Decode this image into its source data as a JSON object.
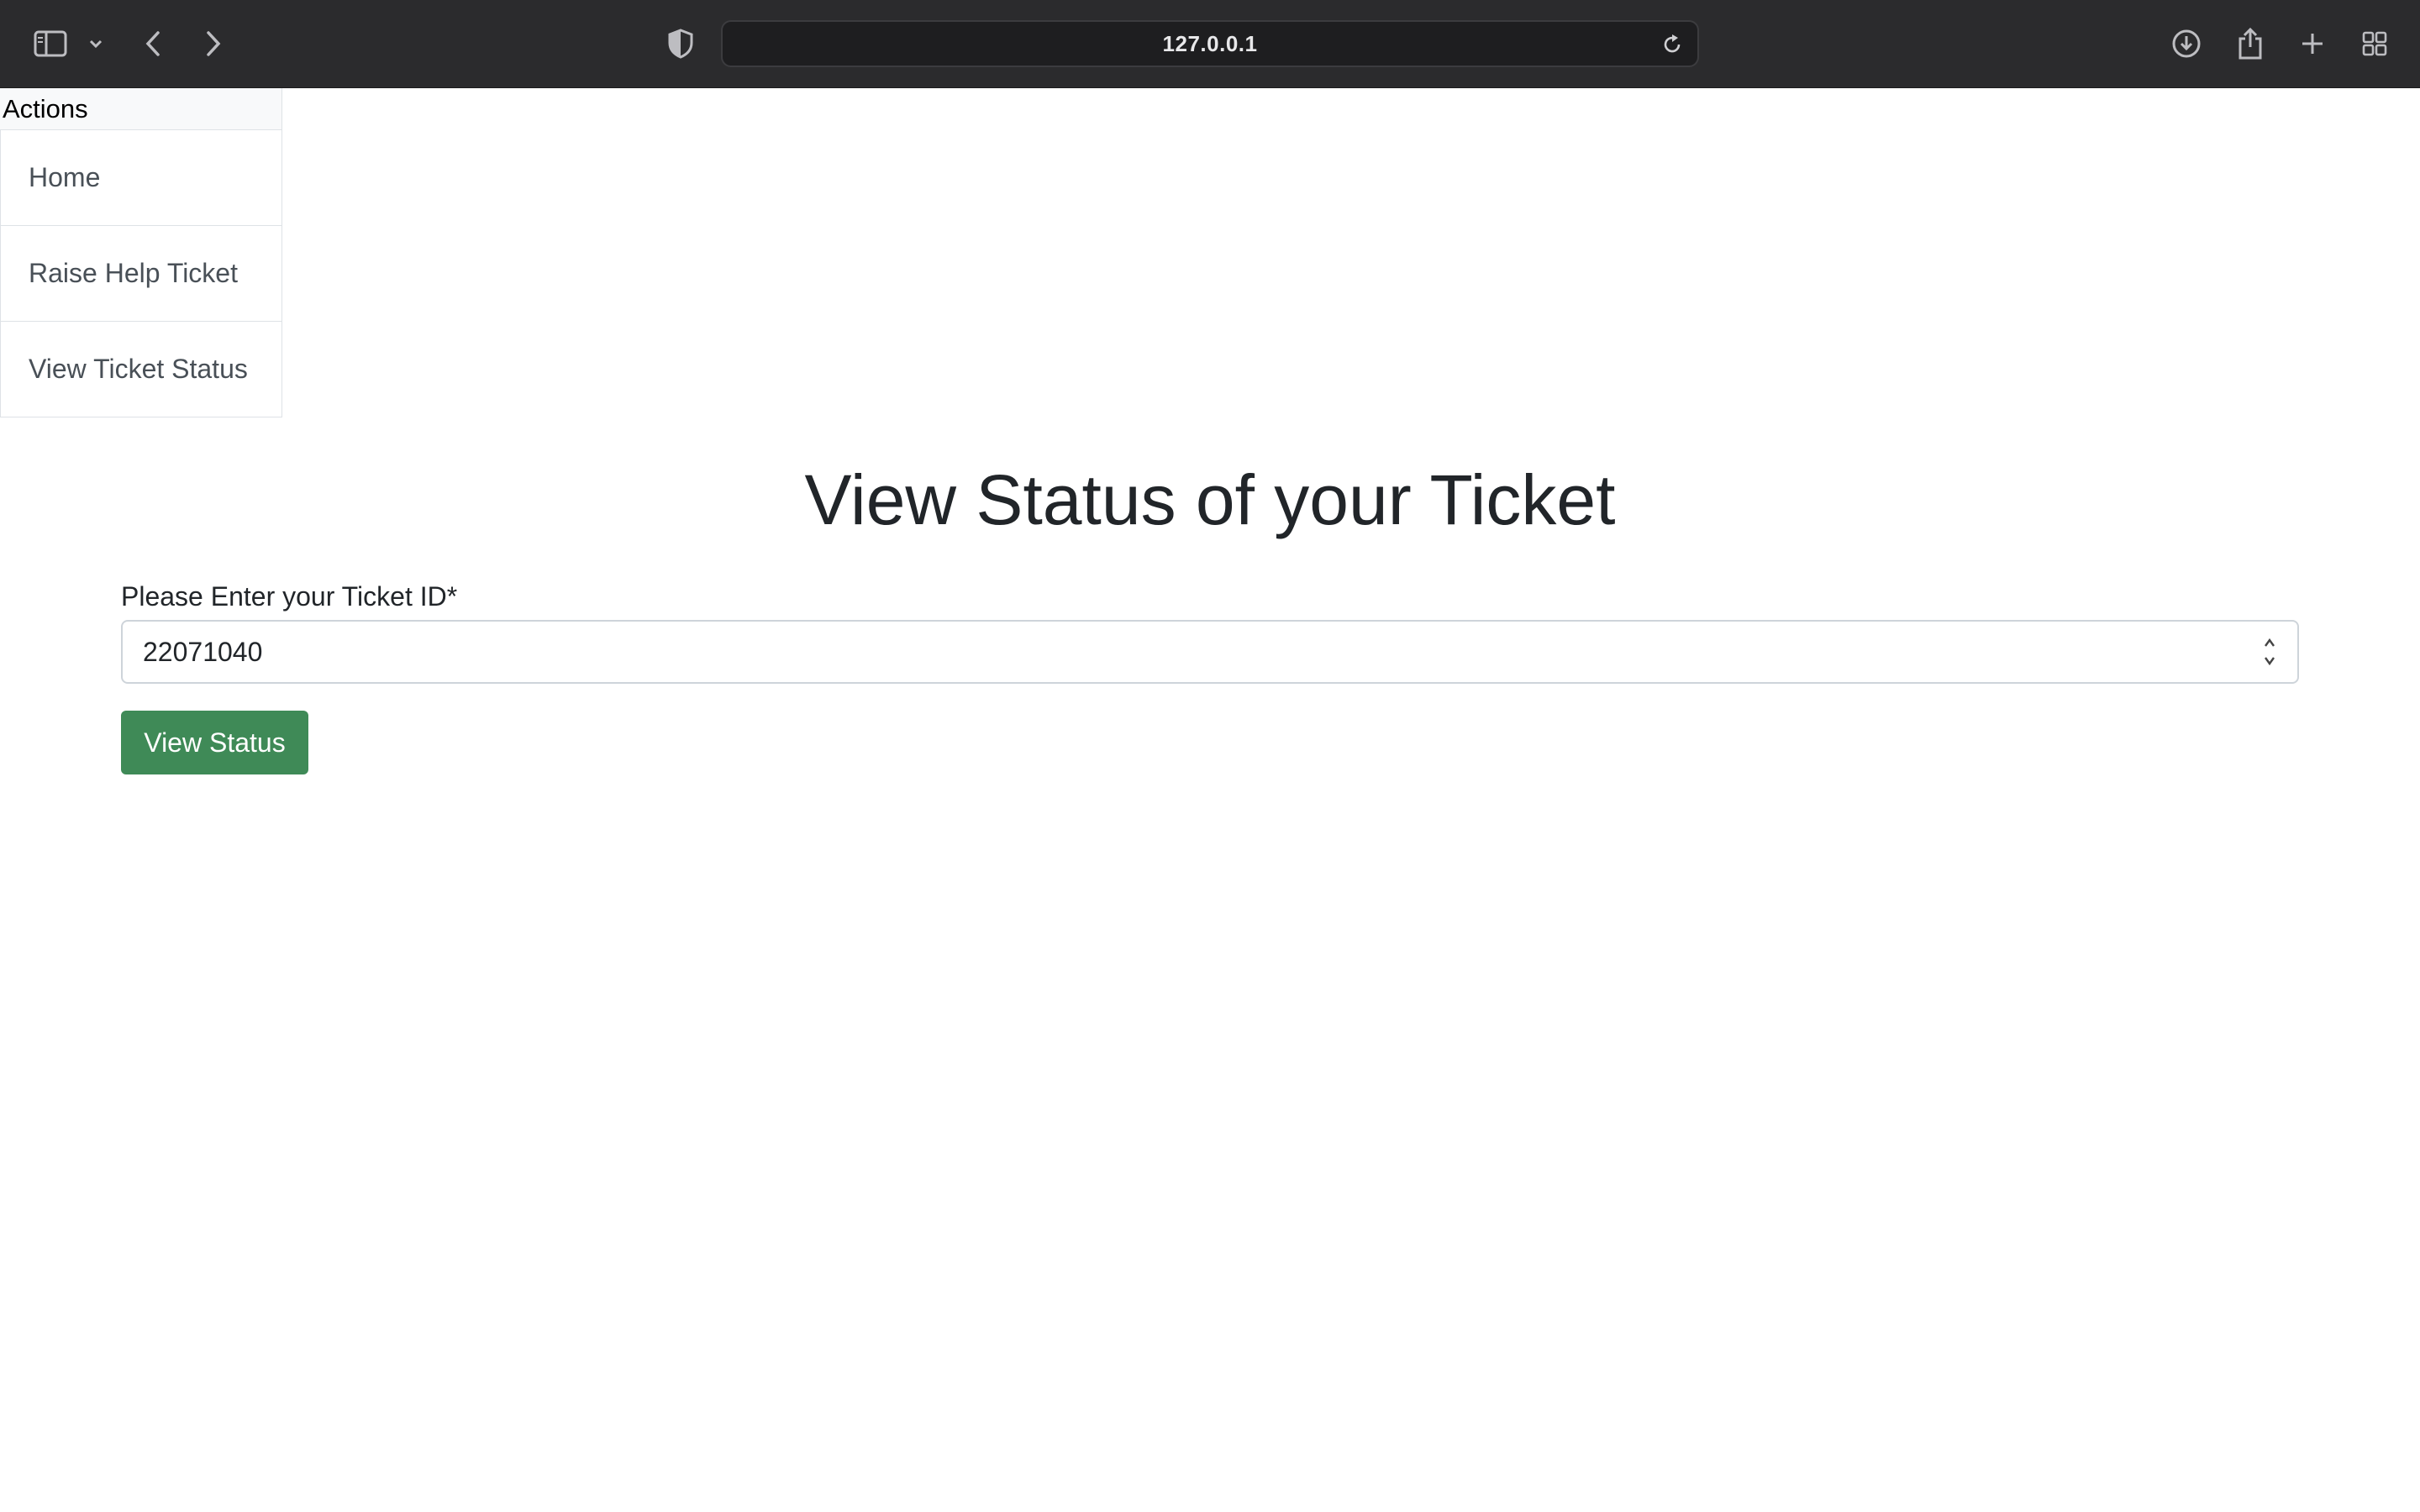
{
  "browser": {
    "url": "127.0.0.1",
    "icons": {
      "sidebar": "sidebar-toggle-icon",
      "chevron": "chevron-down-icon",
      "back": "back-arrow-icon",
      "forward": "forward-arrow-icon",
      "privacy": "shield-icon",
      "reload": "reload-icon",
      "downloads": "download-icon",
      "share": "share-icon",
      "new_tab": "plus-icon",
      "tab_overview": "tab-grid-icon"
    }
  },
  "sidebar": {
    "header": "Actions",
    "items": [
      {
        "label": "Home"
      },
      {
        "label": "Raise Help Ticket"
      },
      {
        "label": "View Ticket Status"
      }
    ]
  },
  "main": {
    "title": "View Status of your Ticket",
    "form": {
      "ticket_label": "Please Enter your Ticket ID*",
      "ticket_value": "22071040",
      "submit_label": "View Status"
    }
  },
  "colors": {
    "toolbar_bg": "#2b2b2d",
    "button_green": "#3f8a57",
    "border": "#dee2e6"
  }
}
